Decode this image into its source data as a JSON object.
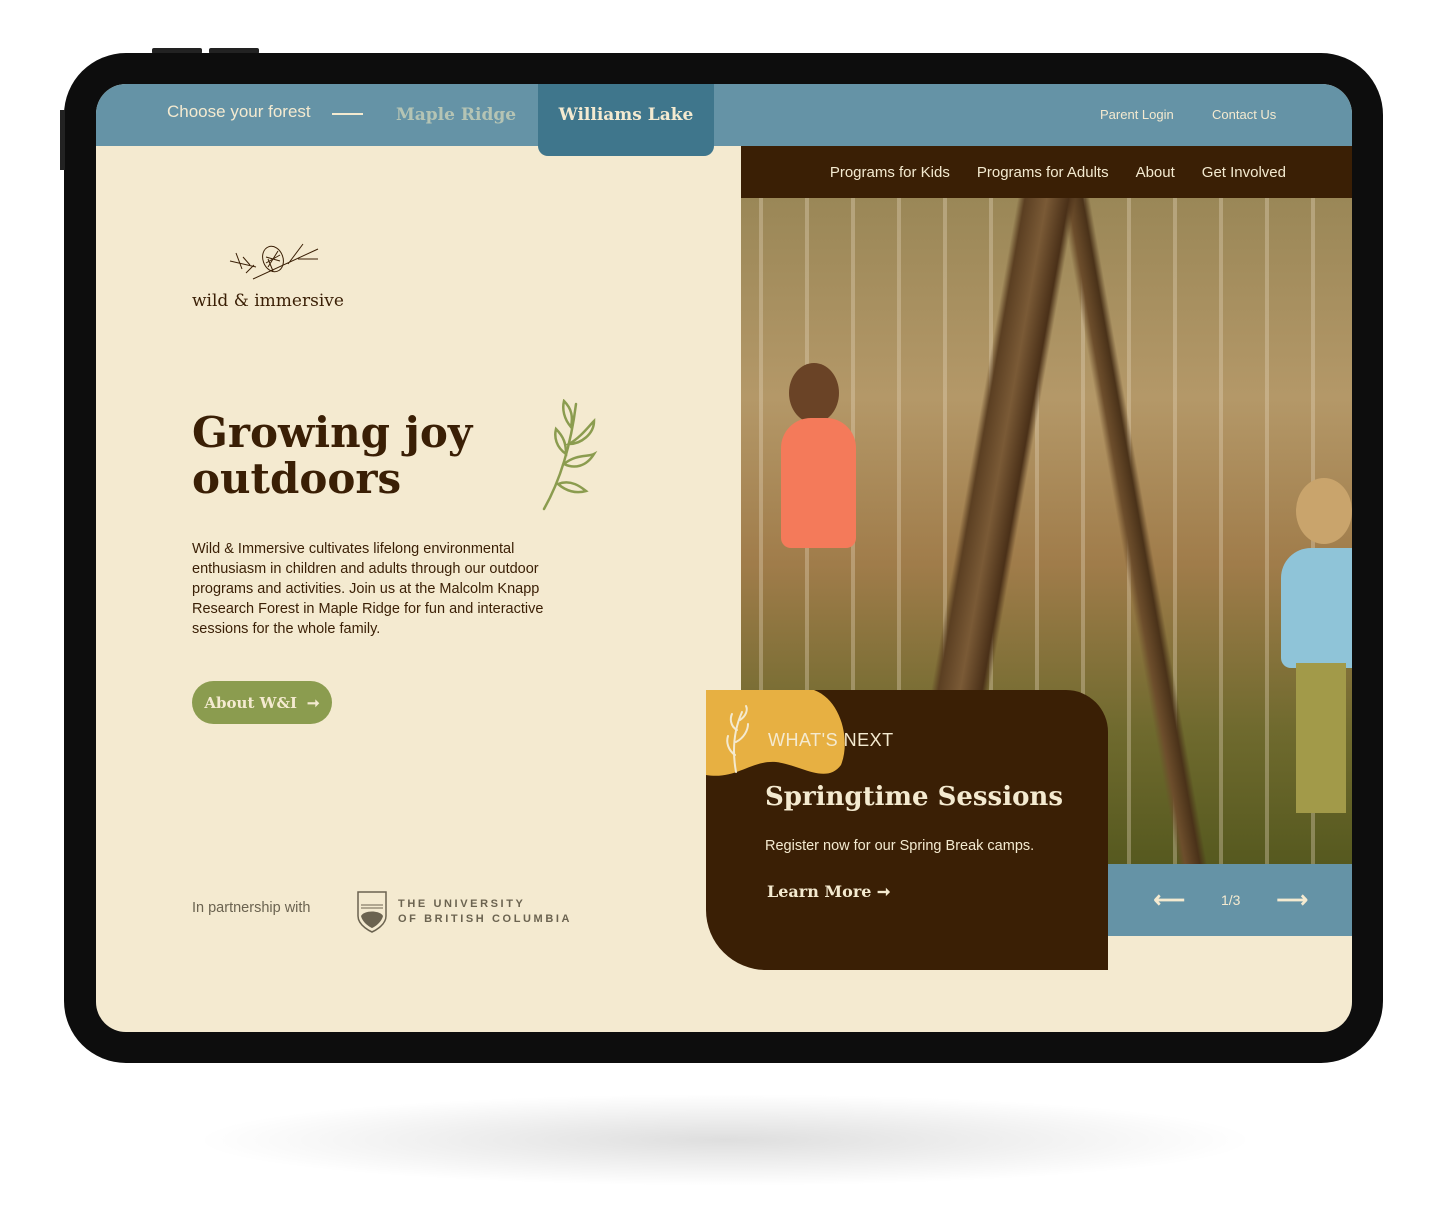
{
  "header": {
    "choose_label": "Choose your forest",
    "forests": [
      {
        "label": "Maple Ridge",
        "active": false
      },
      {
        "label": "Williams Lake",
        "active": true
      }
    ],
    "utility_links": [
      "Parent Login",
      "Contact Us"
    ]
  },
  "nav": {
    "items": [
      "Programs for Kids",
      "Programs for Adults",
      "About",
      "Get Involved"
    ]
  },
  "logo": {
    "text": "wild & immersive"
  },
  "hero": {
    "title": "Growing joy outdoors",
    "body": "Wild & Immersive cultivates lifelong environmental enthusiasm in children and adults through our outdoor programs and activities. Join us at the Malcolm Knapp Research Forest in Maple Ridge for fun and interactive sessions for the whole family.",
    "button_label": "About W&I",
    "button_icon": "arrow-right-icon"
  },
  "partner": {
    "label": "In partnership with",
    "logo_text": "UBC",
    "org_line1": "THE UNIVERSITY",
    "org_line2": "OF BRITISH COLUMBIA"
  },
  "whats_next": {
    "eyebrow": "WHAT'S NEXT",
    "title": "Springtime Sessions",
    "body": "Register now for our Spring Break camps.",
    "link_label": "Learn More"
  },
  "slider": {
    "counter": "1/3",
    "prev_icon": "arrow-left-icon",
    "next_icon": "arrow-right-icon"
  },
  "colors": {
    "cream": "#f4ead0",
    "brown": "#3a1f05",
    "blue": "#6593a6",
    "blue_dark": "#3f768c",
    "green": "#8b9c4f",
    "mustard": "#e7b042"
  }
}
